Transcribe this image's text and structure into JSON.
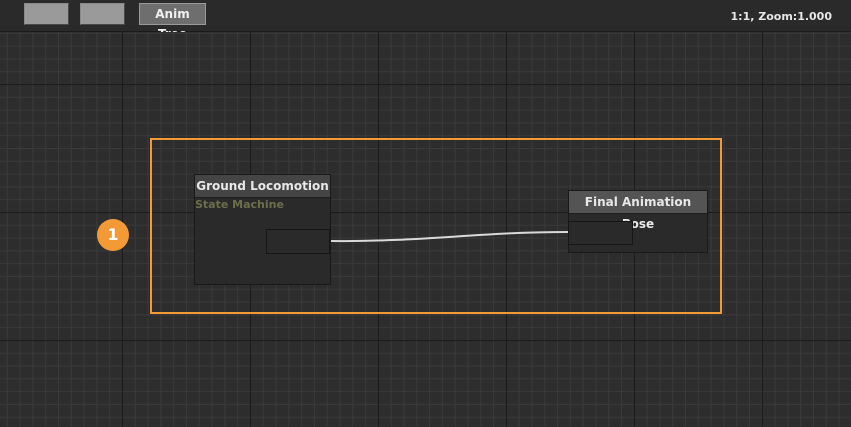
{
  "toolbar": {
    "back_label": "",
    "forward_label": "",
    "anim_tree_label": "Anim Tree",
    "status": "1:1, Zoom:1.000"
  },
  "callout": {
    "number": "1",
    "color": "#f39a37"
  },
  "nodes": {
    "ground": {
      "title": "Ground Locomotion",
      "subtitle": "State Machine"
    },
    "final": {
      "title": "Final Animation Pose"
    }
  },
  "colors": {
    "highlight": "#f39a37",
    "background": "#2c2c2c",
    "wire": "#d9d9d9"
  }
}
